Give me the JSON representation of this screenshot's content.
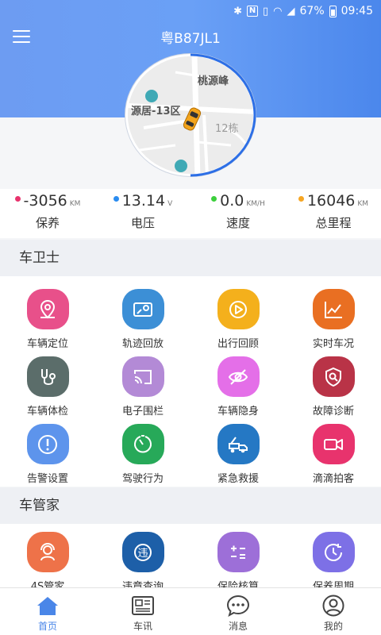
{
  "status_bar": {
    "battery": "67%",
    "time": "09:45"
  },
  "header": {
    "plate": "粤B87JL1"
  },
  "map": {
    "labels": [
      "桃源峰",
      "源居-13区",
      "12栋"
    ]
  },
  "stats": [
    {
      "value": "-3056",
      "unit": "KM",
      "label": "保养",
      "color": "#e8336d"
    },
    {
      "value": "13.14",
      "unit": "V",
      "label": "电压",
      "color": "#2a8cf0"
    },
    {
      "value": "0.0",
      "unit": "KM/H",
      "label": "速度",
      "color": "#3ccf3c"
    },
    {
      "value": "16046",
      "unit": "KM",
      "label": "总里程",
      "color": "#f6a623"
    }
  ],
  "sections": {
    "guard": {
      "title": "车卫士",
      "items": [
        {
          "label": "车辆定位",
          "icon": "location-pin-icon",
          "color": "#e8508a"
        },
        {
          "label": "轨迹回放",
          "icon": "map-track-icon",
          "color": "#3c8fd6"
        },
        {
          "label": "出行回顾",
          "icon": "play-circle-icon",
          "color": "#f4b01c"
        },
        {
          "label": "实时车况",
          "icon": "line-chart-icon",
          "color": "#e96f22"
        },
        {
          "label": "车辆体检",
          "icon": "stethoscope-icon",
          "color": "#5b6d6a"
        },
        {
          "label": "电子围栏",
          "icon": "cast-icon",
          "color": "#b38ad6"
        },
        {
          "label": "车辆隐身",
          "icon": "eye-off-icon",
          "color": "#e46fe8"
        },
        {
          "label": "故障诊断",
          "icon": "shield-search-icon",
          "color": "#b93347"
        },
        {
          "label": "告警设置",
          "icon": "alert-icon",
          "color": "#5d94ec"
        },
        {
          "label": "驾驶行为",
          "icon": "speedometer-icon",
          "color": "#27a959"
        },
        {
          "label": "紧急救援",
          "icon": "tow-truck-icon",
          "color": "#2578c4"
        },
        {
          "label": "滴滴拍客",
          "icon": "video-camera-icon",
          "color": "#e8336d"
        }
      ]
    },
    "steward": {
      "title": "车管家",
      "items": [
        {
          "label": "4S管家",
          "icon": "service-agent-icon",
          "color": "#ee7249"
        },
        {
          "label": "违章查询",
          "icon": "violation-icon",
          "color": "#1d5fa8"
        },
        {
          "label": "保险核算",
          "icon": "calculator-icon",
          "color": "#9d6fd8"
        },
        {
          "label": "保养周期",
          "icon": "clock-cycle-icon",
          "color": "#7d70e6"
        }
      ]
    }
  },
  "tabs": [
    {
      "label": "首页",
      "icon": "home-icon"
    },
    {
      "label": "车讯",
      "icon": "news-icon"
    },
    {
      "label": "消息",
      "icon": "chat-icon"
    },
    {
      "label": "我的",
      "icon": "profile-icon"
    }
  ]
}
